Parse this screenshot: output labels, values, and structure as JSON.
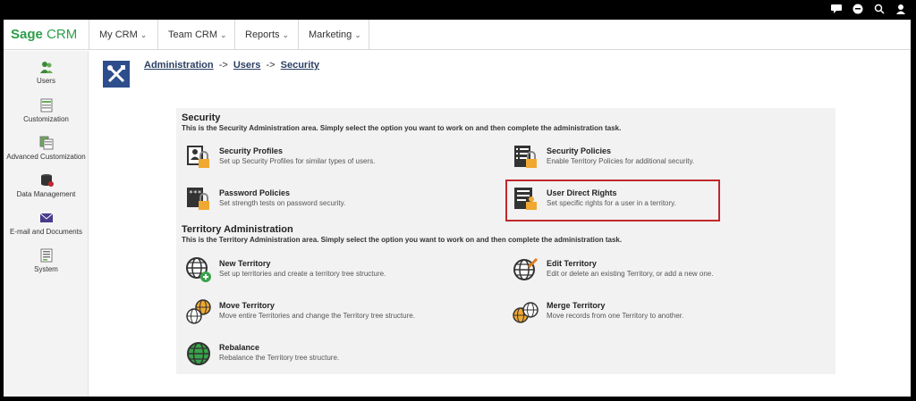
{
  "app": {
    "logo_primary": "Sage",
    "logo_secondary": "CRM"
  },
  "nav": [
    {
      "label": "My CRM"
    },
    {
      "label": "Team CRM"
    },
    {
      "label": "Reports"
    },
    {
      "label": "Marketing"
    }
  ],
  "sidebar": {
    "items": [
      {
        "label": "Users",
        "icon": "users-icon"
      },
      {
        "label": "Customization",
        "icon": "customization-icon"
      },
      {
        "label": "Advanced Customization",
        "icon": "advanced-customization-icon"
      },
      {
        "label": "Data Management",
        "icon": "database-icon"
      },
      {
        "label": "E-mail and Documents",
        "icon": "envelope-icon"
      },
      {
        "label": "System",
        "icon": "system-icon"
      }
    ]
  },
  "breadcrumb": {
    "items": [
      "Administration",
      "Users",
      "Security"
    ],
    "separator": "->"
  },
  "security": {
    "title": "Security",
    "description": "This is the Security Administration area. Simply select the option you want to work on and then complete the administration task.",
    "options": [
      {
        "title": "Security Profiles",
        "desc": "Set up Security Profiles for similar types of users.",
        "icon": "security-profiles-icon"
      },
      {
        "title": "Security Policies",
        "desc": "Enable Territory Policies for additional security.",
        "icon": "security-policies-icon"
      },
      {
        "title": "Password Policies",
        "desc": "Set strength tests on password security.",
        "icon": "password-policies-icon"
      },
      {
        "title": "User Direct Rights",
        "desc": "Set specific rights for a user in a territory.",
        "icon": "user-direct-rights-icon"
      }
    ]
  },
  "territory": {
    "title": "Territory Administration",
    "description": "This is the Territory Administration area. Simply select the option you want to work on and then complete the administration task.",
    "options": [
      {
        "title": "New Territory",
        "desc": "Set up territories and create a territory tree structure.",
        "icon": "new-territory-icon"
      },
      {
        "title": "Edit Territory",
        "desc": "Edit or delete an existing Territory, or add a new one.",
        "icon": "edit-territory-icon"
      },
      {
        "title": "Move Territory",
        "desc": "Move entire Territories and change the Territory tree structure.",
        "icon": "move-territory-icon"
      },
      {
        "title": "Merge Territory",
        "desc": "Move records from one Territory to another.",
        "icon": "merge-territory-icon"
      },
      {
        "title": "Rebalance",
        "desc": "Rebalance the Territory tree structure.",
        "icon": "rebalance-icon"
      }
    ]
  },
  "colors": {
    "brand_green": "#2d9e4a",
    "header_blue": "#2e4d8c",
    "highlight_red": "#c0282d",
    "lock_orange": "#f0a830"
  }
}
